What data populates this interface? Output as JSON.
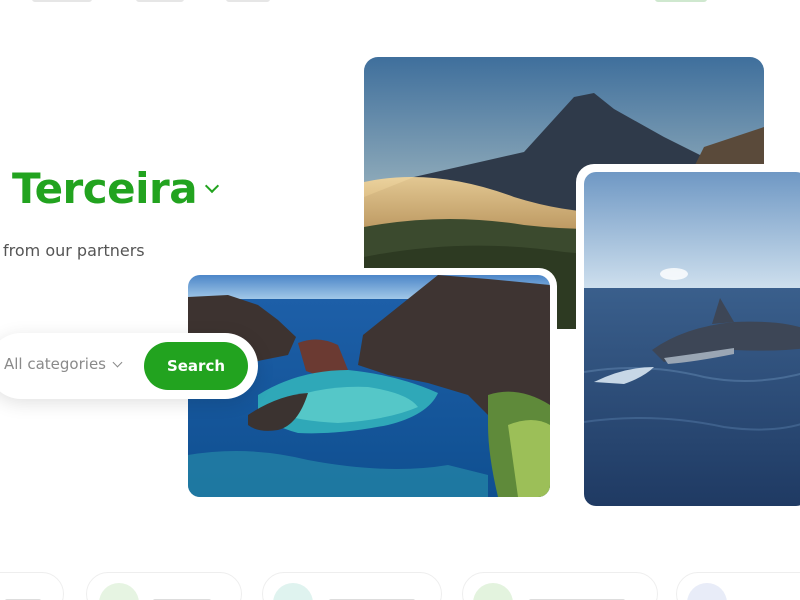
{
  "hero": {
    "title": "Terceira",
    "subtitle": "from our partners"
  },
  "search": {
    "category_value": "All categories",
    "button_label": "Search"
  },
  "colors": {
    "brand_green": "#22a31f",
    "muted_text": "#8a8a8a"
  },
  "icons": {
    "title_dropdown": "chevron-down-icon",
    "category_dropdown": "chevron-down-icon"
  },
  "images": [
    "mountain-sunset-photo",
    "dolphin-photo",
    "coastal-rocks-photo"
  ]
}
